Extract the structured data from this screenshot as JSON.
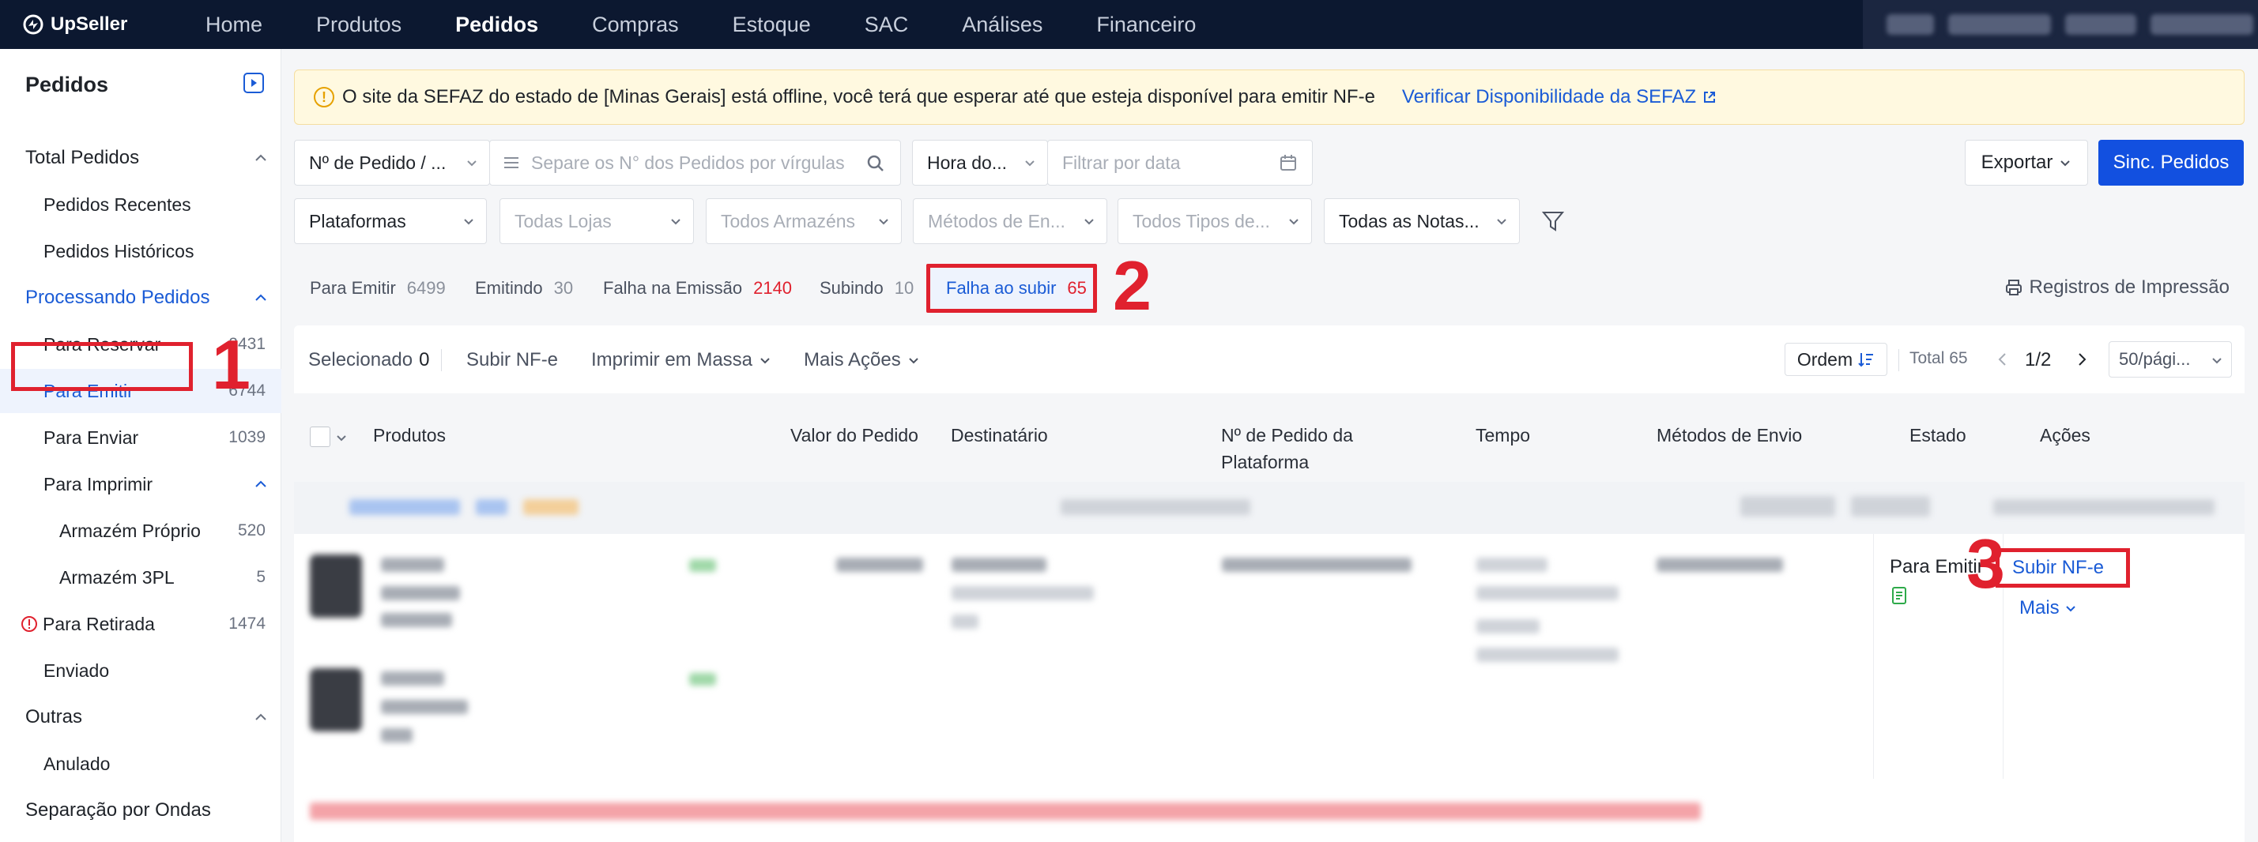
{
  "app": {
    "brand": "UpSeller"
  },
  "topnav": {
    "items": [
      {
        "label": "Home",
        "active": false
      },
      {
        "label": "Produtos",
        "active": false
      },
      {
        "label": "Pedidos",
        "active": true
      },
      {
        "label": "Compras",
        "active": false
      },
      {
        "label": "Estoque",
        "active": false
      },
      {
        "label": "SAC",
        "active": false
      },
      {
        "label": "Análises",
        "active": false
      },
      {
        "label": "Financeiro",
        "active": false
      }
    ]
  },
  "sidebar": {
    "title": "Pedidos",
    "total_pedidos": "Total Pedidos",
    "recentes": "Pedidos Recentes",
    "historicos": "Pedidos Históricos",
    "processando": "Processando Pedidos",
    "para_reservar": {
      "label": "Para Reservar",
      "count": "2431"
    },
    "para_emitir": {
      "label": "Para Emitir",
      "count": "6744"
    },
    "para_enviar": {
      "label": "Para Enviar",
      "count": "1039"
    },
    "para_imprimir": "Para Imprimir",
    "armazem_proprio": {
      "label": "Armazém Próprio",
      "count": "520"
    },
    "armazem_3pl": {
      "label": "Armazém 3PL",
      "count": "5"
    },
    "para_retirada": {
      "label": "Para Retirada",
      "count": "1474"
    },
    "enviado": "Enviado",
    "outras": "Outras",
    "anulado": "Anulado",
    "separacao": "Separação por Ondas"
  },
  "banner": {
    "message": "O site da SEFAZ do estado de [Minas Gerais] está offline, você terá que esperar até que esteja disponível para emitir NF-e",
    "link": "Verificar Disponibilidade da SEFAZ"
  },
  "filters": {
    "order_type": "Nº de Pedido / ...",
    "order_placeholder": "Separe os N° dos Pedidos por vírgulas",
    "time_type": "Hora do...",
    "date_placeholder": "Filtrar por data",
    "plataformas": "Plataformas",
    "lojas": "Todas Lojas",
    "armazens": "Todos Armazéns",
    "metodos": "Métodos de En...",
    "tipos": "Todos Tipos de...",
    "notas": "Todas as Notas..."
  },
  "actions": {
    "exportar": "Exportar",
    "sinc": "Sinc. Pedidos"
  },
  "tabs": [
    {
      "label": "Para Emitir",
      "count": "6499"
    },
    {
      "label": "Emitindo",
      "count": "30"
    },
    {
      "label": "Falha na Emissão",
      "count": "2140"
    },
    {
      "label": "Subindo",
      "count": "10"
    },
    {
      "label": "Falha ao subir",
      "count": "65"
    }
  ],
  "print_log": "Registros de Impressão",
  "toolbar": {
    "selecionado": "Selecionado",
    "selected_count": "0",
    "subir": "Subir NF-e",
    "imprimir": "Imprimir em Massa",
    "mais_acoes": "Mais Ações",
    "ordem": "Ordem",
    "total": "Total 65",
    "page": "1/2",
    "per_page": "50/pági..."
  },
  "table": {
    "headers": {
      "produtos": "Produtos",
      "valor": "Valor do Pedido",
      "destinatario": "Destinatário",
      "plataforma": "Nº de Pedido da Plataforma",
      "tempo": "Tempo",
      "envio": "Métodos de Envio",
      "estado": "Estado",
      "acoes": "Ações"
    },
    "row": {
      "estado": "Para Emitir",
      "subir": "Subir NF-e",
      "mais": "Mais"
    }
  },
  "annotations": {
    "one": "1",
    "two": "2",
    "three": "3"
  },
  "colors": {
    "accent": "#1a5bd6",
    "primary_button": "#1250e0",
    "annotation": "#e0212e",
    "nav_bg": "#0c1830"
  }
}
